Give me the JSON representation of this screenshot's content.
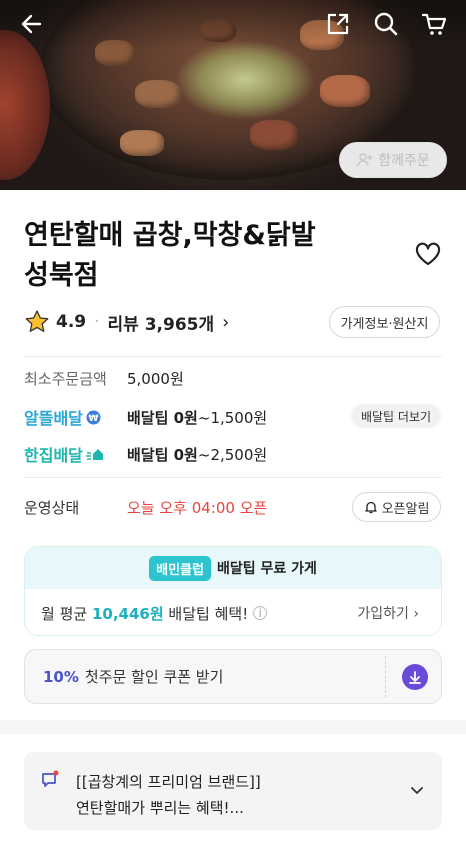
{
  "hero": {
    "together_order_label": "함께주문"
  },
  "store": {
    "title_line1": "연탄할매 곱창,막창&닭발",
    "title_line2": "성북점",
    "rating": "4.9",
    "review_label": "리뷰 3,965개",
    "info_button": "가게정보·원산지"
  },
  "order_info": {
    "min_order_label": "최소주문금액",
    "min_order_value": "5,000원"
  },
  "delivery": {
    "econ_label": "알뜰배달",
    "econ_fee_bold": "배달팁 0원",
    "econ_fee_rest": "~1,500원",
    "single_label": "한집배달",
    "single_fee_bold": "배달팁 0원",
    "single_fee_rest": "~2,500원",
    "more_button": "배달팁 더보기"
  },
  "status": {
    "label": "운영상태",
    "value": "오늘 오후 04:00 오픈",
    "alarm_button": "오픈알림"
  },
  "club": {
    "badge": "배민클럽",
    "head_text": "배달팁 무료 가게",
    "body_prefix": "월 평균",
    "body_amount": "10,446원",
    "body_suffix": "배달팁 혜택!",
    "join_label": "가입하기"
  },
  "coupon": {
    "percent": "10%",
    "text": "첫주문 할인 쿠폰 받기"
  },
  "notice": {
    "line1": "[[곱창계의 프리미엄 브랜드]]",
    "line2": "연탄할매가 뿌리는 혜택!..."
  },
  "colors": {
    "accent_blue": "#29a8d6",
    "accent_teal": "#20b6b0",
    "status_red": "#e8463c",
    "coupon_purple": "#6a4ad8"
  }
}
